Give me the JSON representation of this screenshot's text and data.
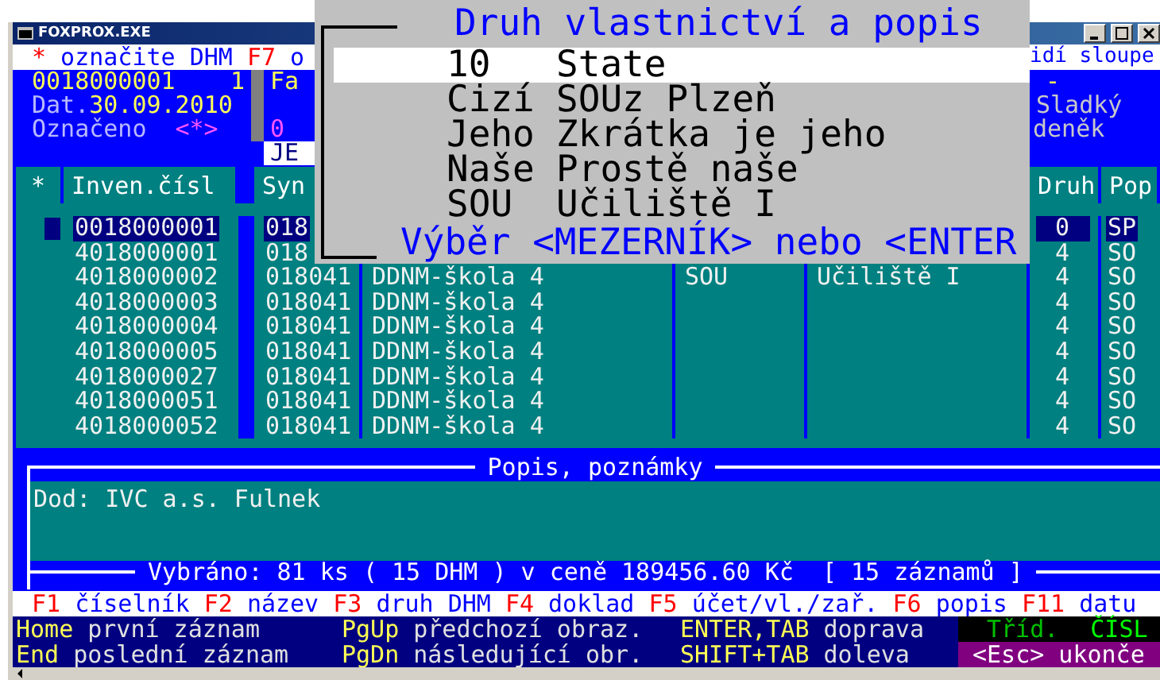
{
  "window": {
    "title": "FOXPROX.EXE"
  },
  "hint_line": {
    "left": [
      {
        "kind": "key",
        "text": "*"
      },
      {
        "kind": "text",
        "text": "označite DHM"
      },
      {
        "kind": "key",
        "text": "F7"
      },
      {
        "kind": "text",
        "text": "o"
      }
    ],
    "right": "idí sloupe"
  },
  "record": {
    "number": "0018000001",
    "count": "1",
    "date_label": "Dat.",
    "date": "30.09.2010",
    "marked_label": "Označeno",
    "marked_symbol": "<*>"
  },
  "middle": {
    "line_1": "Fa",
    "line_3": "0",
    "tab": "JE"
  },
  "right": {
    "line_1": "-",
    "line_2": "Sladký",
    "line_3": "deněk"
  },
  "table": {
    "columns": {
      "star": "*",
      "inven": "Inven.čísl",
      "syn": "Syn",
      "druh": "Druh",
      "pop": "Pop"
    },
    "rows": [
      {
        "selected": true,
        "inven": "0018000001",
        "syn": "018",
        "druh": "0",
        "pop": "SP"
      },
      {
        "selected": false,
        "inven": "4018000001",
        "syn": "018",
        "druh": "4",
        "pop": "SO"
      },
      {
        "selected": false,
        "inven": "4018000002",
        "syn": "018041",
        "name": "DDNM-škola 4",
        "column_4": "SOU",
        "column_5": "Učiliště I",
        "druh": "4",
        "pop": "SO"
      },
      {
        "selected": false,
        "inven": "4018000003",
        "syn": "018041",
        "name": "DDNM-škola 4",
        "druh": "4",
        "pop": "SO"
      },
      {
        "selected": false,
        "inven": "4018000004",
        "syn": "018041",
        "name": "DDNM-škola 4",
        "druh": "4",
        "pop": "SO"
      },
      {
        "selected": false,
        "inven": "4018000005",
        "syn": "018041",
        "name": "DDNM-škola 4",
        "druh": "4",
        "pop": "SO"
      },
      {
        "selected": false,
        "inven": "4018000027",
        "syn": "018041",
        "name": "DDNM-škola 4",
        "druh": "4",
        "pop": "SO"
      },
      {
        "selected": false,
        "inven": "4018000051",
        "syn": "018041",
        "name": "DDNM-škola 4",
        "druh": "4",
        "pop": "SO"
      },
      {
        "selected": false,
        "inven": "4018000052",
        "syn": "018041",
        "name": "DDNM-škola 4",
        "druh": "4",
        "pop": "SO"
      }
    ]
  },
  "popup": {
    "title": "Druh vlastnictví a popis",
    "items": [
      {
        "code": "10",
        "label": "State",
        "selected": true
      },
      {
        "code": "Cizí",
        "label": "SOUz Plzeň",
        "selected": false
      },
      {
        "code": "Jeho",
        "label": "Zkrátka je jeho",
        "selected": false
      },
      {
        "code": "Naše",
        "label": "Prostě naše",
        "selected": false
      },
      {
        "code": "SOU",
        "label": "Učiliště I",
        "selected": false
      }
    ],
    "footer": "Výběr <MEZERNÍK> nebo <ENTER"
  },
  "notes": {
    "title": "Popis, poznámky",
    "text": "Dod: IVC a.s. Fulnek"
  },
  "summary": "Vybráno: 81 ks ( 15 DHM ) v ceně 189456.60 Kč  [ 15 záznamů ]",
  "function_keys": [
    {
      "key": "F1",
      "label": "číselník"
    },
    {
      "key": "F2",
      "label": "název"
    },
    {
      "key": "F3",
      "label": "druh DHM"
    },
    {
      "key": "F4",
      "label": "doklad"
    },
    {
      "key": "F5",
      "label": "účet/vl./zař."
    },
    {
      "key": "F6",
      "label": "popis"
    },
    {
      "key": "F11",
      "label": "datu"
    }
  ],
  "help_rows": [
    [
      {
        "key": "Home",
        "label": "první záznam"
      },
      {
        "key": "PgUp",
        "label": "předchozí obraz."
      },
      {
        "key": "ENTER,TAB",
        "label": "doprava"
      }
    ],
    [
      {
        "key": "End",
        "label": "poslední záznam"
      },
      {
        "key": "PgDn",
        "label": "následující obr."
      },
      {
        "key": "SHIFT+TAB",
        "label": "doleva"
      }
    ]
  ],
  "sort": {
    "label": "Tříd.",
    "value": "ČÍSL"
  },
  "exit": "<Esc> ukonče"
}
